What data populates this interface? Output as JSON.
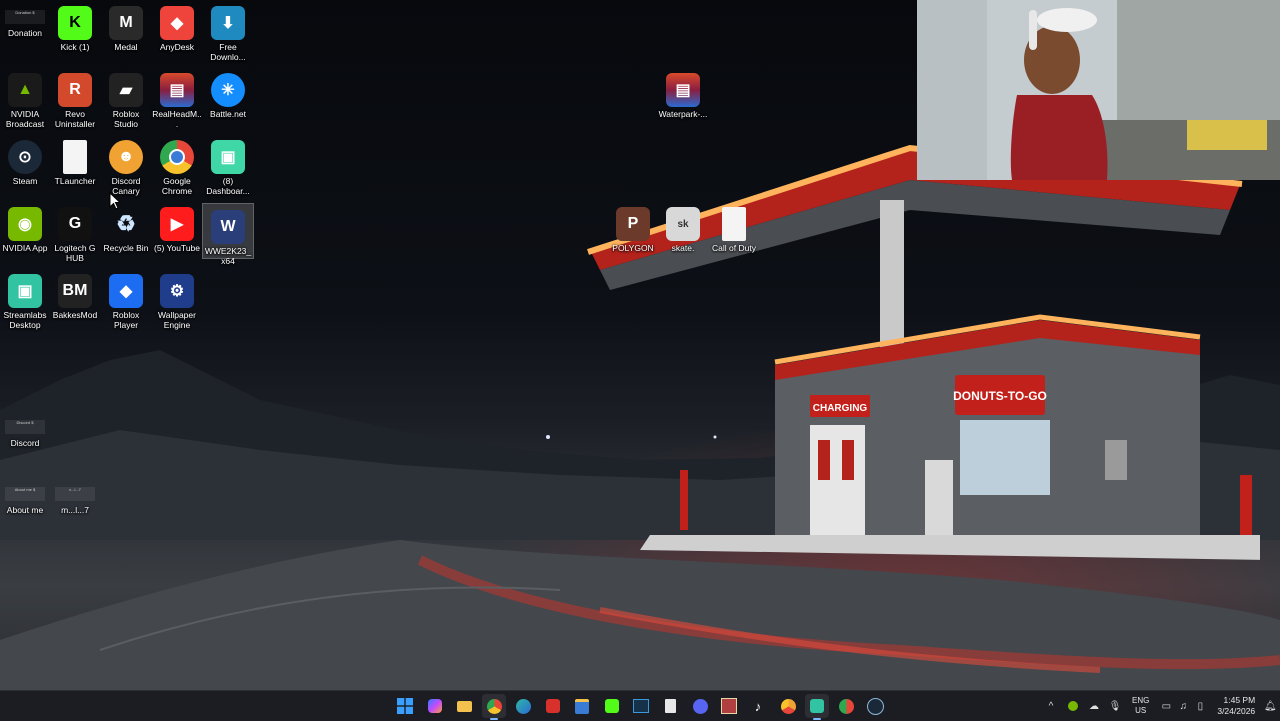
{
  "desktop": {
    "icons": [
      {
        "id": "donation",
        "label": "Donation",
        "thumb": "Donation $"
      },
      {
        "id": "kick",
        "label": "Kick (1)",
        "color": "#53fc18"
      },
      {
        "id": "medal",
        "label": "Medal",
        "color": "#2a2a2a"
      },
      {
        "id": "anydesk",
        "label": "AnyDesk",
        "color": "#ef443b"
      },
      {
        "id": "free-download",
        "label": "Free Downlo...",
        "color": "#1f8ac0"
      },
      {
        "id": "nvidia-broadcast",
        "label": "NVIDIA Broadcast",
        "color": "#1a1a1a"
      },
      {
        "id": "revo",
        "label": "Revo Uninstaller",
        "color": "#d24a2b"
      },
      {
        "id": "roblox-studio",
        "label": "Roblox Studio",
        "color": "#222222"
      },
      {
        "id": "realheadm",
        "label": "RealHeadM...",
        "color": "#8b1e3f"
      },
      {
        "id": "battlenet",
        "label": "Battle.net",
        "color": "#148eff"
      },
      {
        "id": "steam",
        "label": "Steam",
        "color": "#1b2838"
      },
      {
        "id": "tlauncher",
        "label": "TLauncher",
        "color": "#f4f4f4"
      },
      {
        "id": "discord-canary",
        "label": "Discord Canary",
        "color": "#f0a332"
      },
      {
        "id": "google-chrome",
        "label": "Google Chrome",
        "color": "#e9463a"
      },
      {
        "id": "dashboard",
        "label": "(8) Dashboar...",
        "color": "#3fd7a5"
      },
      {
        "id": "nvidia-app",
        "label": "NVIDIA App",
        "color": "#76b900"
      },
      {
        "id": "logitech",
        "label": "Logitech G HUB",
        "color": "#111111"
      },
      {
        "id": "recycle-bin",
        "label": "Recycle Bin",
        "color": "#5aa0d8"
      },
      {
        "id": "youtube",
        "label": "(5) YouTube",
        "color": "#ff1c1c"
      },
      {
        "id": "wwe",
        "label": "WWE2K23_x64",
        "color": "#2a3e7a"
      },
      {
        "id": "streamlabs",
        "label": "Streamlabs Desktop",
        "color": "#31c3a2"
      },
      {
        "id": "bakkesmod",
        "label": "BakkesMod",
        "color": "#222222"
      },
      {
        "id": "roblox-player",
        "label": "Roblox Player",
        "color": "#1d6df2"
      },
      {
        "id": "wallpaper-engine",
        "label": "Wallpaper Engine",
        "color": "#1f3d8a"
      },
      {
        "id": "discord",
        "label": "Discord",
        "thumb": "Discord $"
      },
      {
        "id": "about-me",
        "label": "About me",
        "thumb": "About me $"
      },
      {
        "id": "ml7",
        "label": "m...l...7",
        "thumb": "x...l...7"
      },
      {
        "id": "waterpark",
        "label": "Waterpark-...",
        "color": "#8b1e3f"
      },
      {
        "id": "polygon",
        "label": "POLYGON",
        "color": "#6b3a2a"
      },
      {
        "id": "skate",
        "label": "skate.",
        "color": "#d8d8d8"
      },
      {
        "id": "call-of-duty",
        "label": "Call of Duty",
        "color": "#f4f4f4"
      }
    ]
  },
  "wallpaper": {
    "charging_sign": "CHARGING",
    "donuts_sign": "DONUTS-TO-GO"
  },
  "taskbar": {
    "apps": [
      {
        "name": "start",
        "icon": "windows-icon",
        "color": "#3aa0ff"
      },
      {
        "name": "copilot",
        "icon": "copilot-icon",
        "color": "#6a8cff"
      },
      {
        "name": "file-explorer",
        "icon": "folder-icon",
        "color": "#f2c14e"
      },
      {
        "name": "chrome",
        "icon": "chrome-icon",
        "color": "#e9463a",
        "active": true
      },
      {
        "name": "edge",
        "icon": "edge-icon",
        "color": "#2fb8a8"
      },
      {
        "name": "app-red",
        "icon": "app-icon",
        "color": "#d8312b"
      },
      {
        "name": "store",
        "icon": "store-icon",
        "color": "#3a7bd5"
      },
      {
        "name": "kick",
        "icon": "kick-icon",
        "color": "#53fc18"
      },
      {
        "name": "app-window",
        "icon": "window-icon",
        "color": "#3a9ad9"
      },
      {
        "name": "notepad",
        "icon": "document-icon",
        "color": "#e8e8e8"
      },
      {
        "name": "discord",
        "icon": "discord-icon",
        "color": "#5865f2"
      },
      {
        "name": "app-box",
        "icon": "box-icon",
        "color": "#b04040"
      },
      {
        "name": "tiktok",
        "icon": "tiktok-icon",
        "color": "#111111"
      },
      {
        "name": "chrome-alt",
        "icon": "chrome-icon",
        "color": "#f0a332"
      },
      {
        "name": "streamlabs",
        "icon": "streamlabs-icon",
        "color": "#31c3a2",
        "active": true
      },
      {
        "name": "app-multi",
        "icon": "app-icon",
        "color": "#e9463a"
      },
      {
        "name": "steam",
        "icon": "steam-icon",
        "color": "#1b2838"
      }
    ],
    "tray": {
      "language": "ENG",
      "region": "US",
      "time": "1:45 PM",
      "date": "3/24/2026"
    }
  }
}
